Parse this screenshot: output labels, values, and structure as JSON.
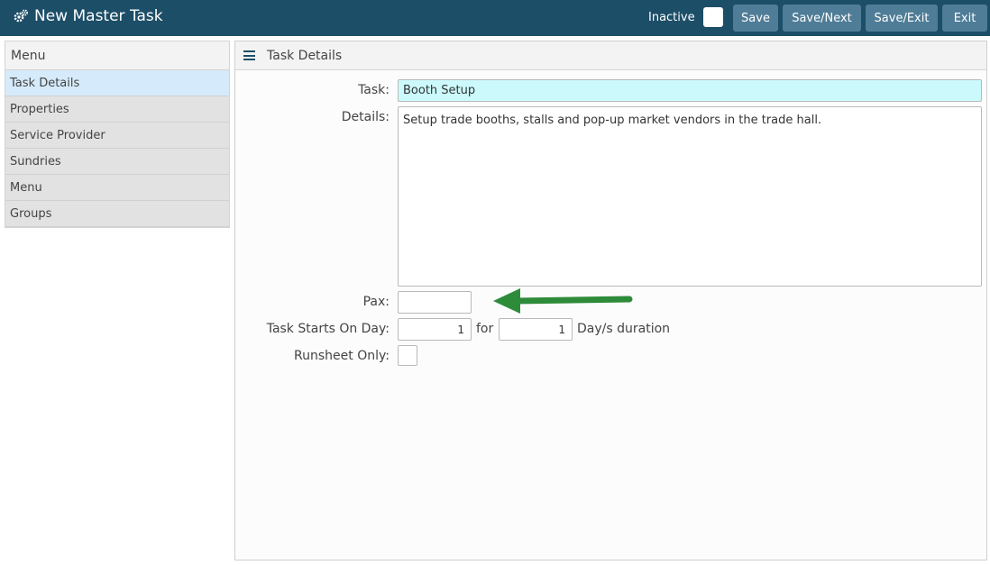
{
  "header": {
    "title": "New Master Task",
    "inactive_label": "Inactive",
    "buttons": {
      "save": "Save",
      "save_next": "Save/Next",
      "save_exit": "Save/Exit",
      "exit": "Exit"
    }
  },
  "sidebar": {
    "title": "Menu",
    "items": [
      {
        "label": "Task Details"
      },
      {
        "label": "Properties"
      },
      {
        "label": "Service Provider"
      },
      {
        "label": "Sundries"
      },
      {
        "label": "Menu"
      },
      {
        "label": "Groups"
      }
    ]
  },
  "panel": {
    "title": "Task Details",
    "task_label": "Task:",
    "task_value": "Booth Setup",
    "details_label": "Details:",
    "details_value": "Setup trade booths, stalls and pop-up market vendors in the trade hall.",
    "pax_label": "Pax:",
    "pax_value": "",
    "start_label": "Task Starts On Day:",
    "start_value": "1",
    "for_text": "for",
    "duration_value": "1",
    "duration_suffix": "Day/s duration",
    "runsheet_label": "Runsheet Only:"
  },
  "colors": {
    "header_bg": "#1d4e68",
    "button_bg": "#4f7d97",
    "active_item": "#d5ebfb",
    "task_field_bg": "#ccfafc",
    "arrow": "#2e8b3a"
  }
}
